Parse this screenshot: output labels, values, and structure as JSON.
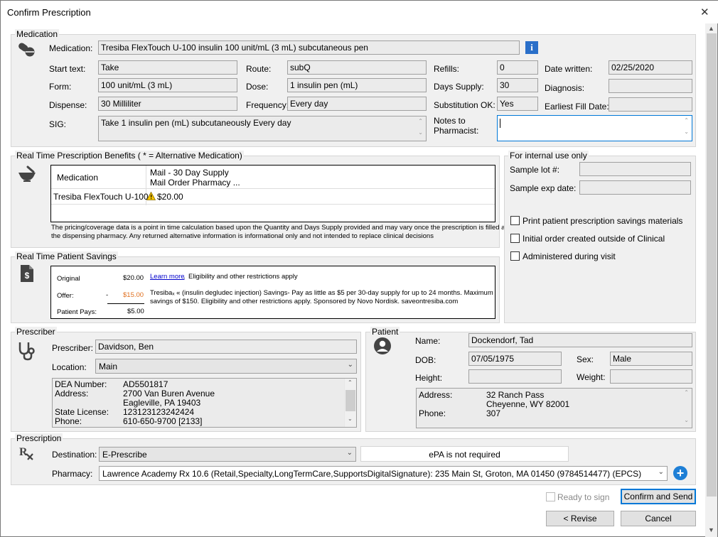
{
  "window": {
    "title": "Confirm Prescription"
  },
  "medication": {
    "group_label": "Medication",
    "medication_label": "Medication:",
    "medication_value": "Tresiba FlexTouch U-100 insulin 100 unit/mL (3 mL) subcutaneous pen",
    "start_text_label": "Start text:",
    "start_text_value": "Take",
    "form_label": "Form:",
    "form_value": "100 unit/mL (3 mL)",
    "dispense_label": "Dispense:",
    "dispense_value": "30 Milliliter",
    "sig_label": "SIG:",
    "sig_value": "Take 1 insulin pen (mL) subcutaneously Every day",
    "route_label": "Route:",
    "route_value": "subQ",
    "dose_label": "Dose:",
    "dose_value": "1 insulin pen (mL)",
    "frequency_label": "Frequency:",
    "frequency_value": "Every day",
    "refills_label": "Refills:",
    "refills_value": "0",
    "days_supply_label": "Days Supply:",
    "days_supply_value": "30",
    "substitution_label": "Substitution OK:",
    "substitution_value": "Yes",
    "notes_label_1": "Notes to",
    "notes_label_2": "Pharmacist:",
    "notes_value": "",
    "date_written_label": "Date written:",
    "date_written_value": "02/25/2020",
    "diagnosis_label": "Diagnosis:",
    "diagnosis_value": "",
    "earliest_fill_label": "Earliest Fill Date:",
    "earliest_fill_value": ""
  },
  "rtpb": {
    "group_label": "Real Time Prescription Benefits ( * = Alternative Medication)",
    "col_medication": "Medication",
    "col_mail_1": "Mail - 30 Day Supply",
    "col_mail_2": "Mail Order Pharmacy ...",
    "row_medication": "Tresiba FlexTouch U-100...",
    "row_price": "$20.00",
    "disclaimer_1": "The pricing/coverage data is a point in time calculation based upon the Quantity and Days Supply provided and may vary once the prescription is filled at",
    "disclaimer_2": "the dispensing pharmacy. Any returned alternative information is informational only and not intended to replace clinical decisions"
  },
  "internal": {
    "group_label": "For internal use only",
    "sample_lot_label": "Sample lot #:",
    "sample_lot_value": "",
    "sample_exp_label": "Sample exp date:",
    "sample_exp_value": "",
    "print_savings_label": "Print patient prescription savings materials",
    "initial_order_label": "Initial order created outside of Clinical",
    "administered_label": "Administered during visit"
  },
  "savings": {
    "group_label": "Real Time Patient Savings",
    "original_label": "Original",
    "original_value": "$20.00",
    "offer_label": "Offer:",
    "offer_dash": "-",
    "offer_value": "$15.00",
    "patient_pays_label": "Patient Pays:",
    "patient_pays_value": "$5.00",
    "learn_more": "Learn more",
    "eligibility": "Eligibility and other restrictions apply",
    "desc_1": "Tresibaₓ « (insulin degludec injection) Savings- Pay as little as $5 per 30-day supply for up to 24 months. Maximum",
    "desc_2": "savings of $150. Eligibility and other restrictions apply. Sponsored by Novo Nordisk. saveontresiba.com"
  },
  "prescriber": {
    "group_label": "Prescriber",
    "prescriber_label": "Prescriber:",
    "prescriber_value": "Davidson, Ben",
    "location_label": "Location:",
    "location_value": "Main",
    "details": [
      {
        "k": "DEA Number:",
        "v": "AD5501817"
      },
      {
        "k": "Address:",
        "v": "2700 Van Buren Avenue"
      },
      {
        "k": "",
        "v": "Eagleville, PA 19403"
      },
      {
        "k": "State License:",
        "v": "123123123242424"
      },
      {
        "k": "Phone:",
        "v": "610-650-9700 [2133]"
      }
    ]
  },
  "patient": {
    "group_label": "Patient",
    "name_label": "Name:",
    "name_value": "Dockendorf, Tad",
    "dob_label": "DOB:",
    "dob_value": "07/05/1975",
    "sex_label": "Sex:",
    "sex_value": "Male",
    "height_label": "Height:",
    "height_value": "",
    "weight_label": "Weight:",
    "weight_value": "",
    "address_label": "Address:",
    "address_1": "32 Ranch Pass",
    "address_2": "Cheyenne, WY 82001",
    "phone_label": "Phone:",
    "phone_value": "307"
  },
  "prescription": {
    "group_label": "Prescription",
    "destination_label": "Destination:",
    "destination_value": "E-Prescribe",
    "epa_status": "ePA is not required",
    "pharmacy_label": "Pharmacy:",
    "pharmacy_value": "Lawrence Academy Rx 10.6 (Retail,Specialty,LongTermCare,SupportsDigitalSignature):  235 Main St, Groton, MA 01450 (9784514477) (EPCS)"
  },
  "footer": {
    "ready_to_sign": "Ready to sign",
    "confirm_send": "Confirm and Send",
    "revise": "< Revise",
    "cancel": "Cancel"
  },
  "colors": {
    "offer_orange": "#e07020",
    "link_blue": "#0000cc",
    "info_blue": "#2a6fc9",
    "add_blue": "#1e7fd6",
    "primary_border": "#0078d7"
  }
}
